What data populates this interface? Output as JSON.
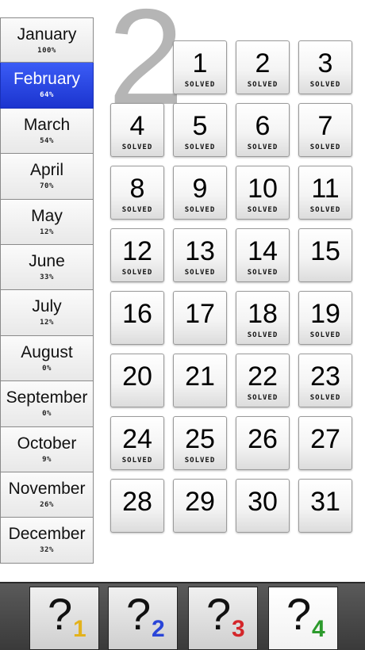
{
  "months": [
    {
      "name": "January",
      "percent": "100%"
    },
    {
      "name": "February",
      "percent": "64%"
    },
    {
      "name": "March",
      "percent": "54%"
    },
    {
      "name": "April",
      "percent": "70%"
    },
    {
      "name": "May",
      "percent": "12%"
    },
    {
      "name": "June",
      "percent": "33%"
    },
    {
      "name": "July",
      "percent": "12%"
    },
    {
      "name": "August",
      "percent": "0%"
    },
    {
      "name": "September",
      "percent": "0%"
    },
    {
      "name": "October",
      "percent": "9%"
    },
    {
      "name": "November",
      "percent": "26%"
    },
    {
      "name": "December",
      "percent": "32%"
    }
  ],
  "selected_month_index": 1,
  "month_number": "2",
  "days": [
    {
      "n": "1",
      "status": "SOLVED"
    },
    {
      "n": "2",
      "status": "SOLVED"
    },
    {
      "n": "3",
      "status": "SOLVED"
    },
    {
      "n": "4",
      "status": "SOLVED"
    },
    {
      "n": "5",
      "status": "SOLVED"
    },
    {
      "n": "6",
      "status": "SOLVED"
    },
    {
      "n": "7",
      "status": "SOLVED"
    },
    {
      "n": "8",
      "status": "SOLVED"
    },
    {
      "n": "9",
      "status": "SOLVED"
    },
    {
      "n": "10",
      "status": "SOLVED"
    },
    {
      "n": "11",
      "status": "SOLVED"
    },
    {
      "n": "12",
      "status": "SOLVED"
    },
    {
      "n": "13",
      "status": "SOLVED"
    },
    {
      "n": "14",
      "status": "SOLVED"
    },
    {
      "n": "15",
      "status": ""
    },
    {
      "n": "16",
      "status": ""
    },
    {
      "n": "17",
      "status": ""
    },
    {
      "n": "18",
      "status": "SOLVED"
    },
    {
      "n": "19",
      "status": "SOLVED"
    },
    {
      "n": "20",
      "status": ""
    },
    {
      "n": "21",
      "status": ""
    },
    {
      "n": "22",
      "status": "SOLVED"
    },
    {
      "n": "23",
      "status": "SOLVED"
    },
    {
      "n": "24",
      "status": "SOLVED"
    },
    {
      "n": "25",
      "status": "SOLVED"
    },
    {
      "n": "26",
      "status": ""
    },
    {
      "n": "27",
      "status": ""
    },
    {
      "n": "28",
      "status": ""
    },
    {
      "n": "29",
      "status": ""
    },
    {
      "n": "30",
      "status": ""
    },
    {
      "n": "31",
      "status": ""
    }
  ],
  "tabs": [
    {
      "symbol": "?",
      "sub": "1",
      "color": "#e3b21c"
    },
    {
      "symbol": "?",
      "sub": "2",
      "color": "#2a45d8"
    },
    {
      "symbol": "?",
      "sub": "3",
      "color": "#d4262a"
    },
    {
      "symbol": "?",
      "sub": "4",
      "color": "#2c9a2c"
    }
  ],
  "active_tab_index": 3
}
